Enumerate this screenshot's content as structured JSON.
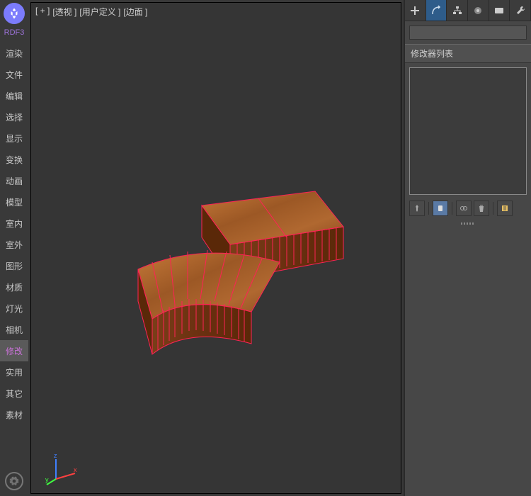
{
  "app": {
    "name": "RDF3"
  },
  "sidebar": {
    "items": [
      {
        "label": "渲染",
        "active": false
      },
      {
        "label": "文件",
        "active": false
      },
      {
        "label": "编辑",
        "active": false
      },
      {
        "label": "选择",
        "active": false
      },
      {
        "label": "显示",
        "active": false
      },
      {
        "label": "变换",
        "active": false
      },
      {
        "label": "动画",
        "active": false
      },
      {
        "label": "模型",
        "active": false
      },
      {
        "label": "室内",
        "active": false
      },
      {
        "label": "室外",
        "active": false
      },
      {
        "label": "图形",
        "active": false
      },
      {
        "label": "材质",
        "active": false
      },
      {
        "label": "灯光",
        "active": false
      },
      {
        "label": "相机",
        "active": false
      },
      {
        "label": "修改",
        "active": true
      },
      {
        "label": "实用",
        "active": false
      },
      {
        "label": "其它",
        "active": false
      },
      {
        "label": "素材",
        "active": false
      }
    ]
  },
  "viewport": {
    "labels": [
      "[ + ]",
      "[透视 ]",
      "[用户定义 ]",
      "[边面 ]"
    ]
  },
  "rightPanel": {
    "modifierListTitle": "修改器列表",
    "objectName": ""
  }
}
